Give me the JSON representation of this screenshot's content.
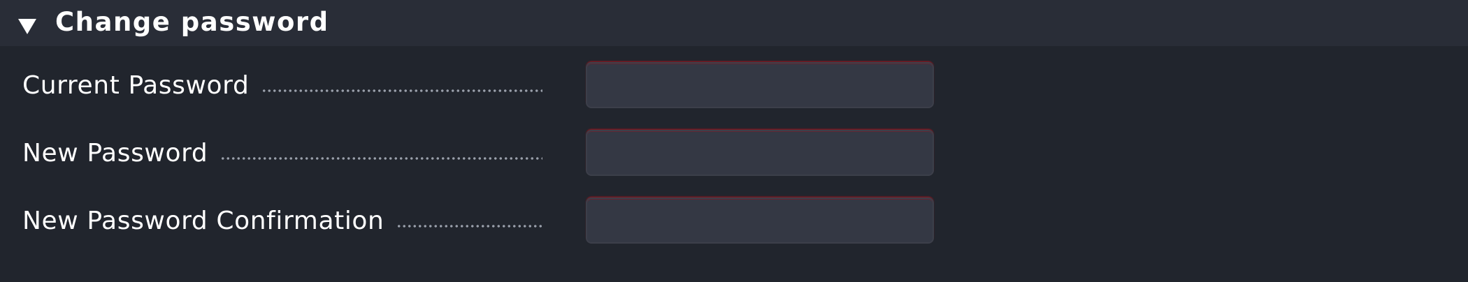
{
  "section": {
    "title": "Change password",
    "collapse_icon": "triangle-down-icon"
  },
  "fields": [
    {
      "label": "Current Password",
      "value": ""
    },
    {
      "label": "New Password",
      "value": ""
    },
    {
      "label": "New Password Confirmation",
      "value": ""
    }
  ],
  "colors": {
    "background": "#21252d",
    "header_background": "#292d37",
    "input_background": "#343844",
    "input_error_border": "#b4141e",
    "text": "#ffffff"
  }
}
